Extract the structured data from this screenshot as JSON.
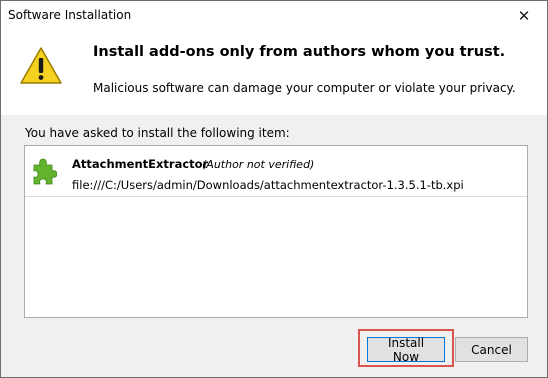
{
  "window": {
    "title": "Software Installation"
  },
  "header": {
    "heading": "Install add-ons only from authors whom you trust.",
    "subtext": "Malicious software can damage your computer or violate your privacy."
  },
  "list": {
    "label": "You have asked to install the following item:",
    "items": [
      {
        "name": "AttachmentExtractor",
        "author": "(Author not verified)",
        "url": "file:///C:/Users/admin/Downloads/attachmentextractor-1.3.5.1-tb.xpi",
        "icon": "puzzle-piece-icon"
      }
    ]
  },
  "buttons": {
    "install": "Install Now",
    "cancel": "Cancel"
  },
  "icons": {
    "warning": "warning-triangle-icon",
    "close": "close-icon"
  },
  "colors": {
    "highlight": "#d9534f",
    "puzzle": "#63b32e",
    "warning": "#f5d21f"
  }
}
